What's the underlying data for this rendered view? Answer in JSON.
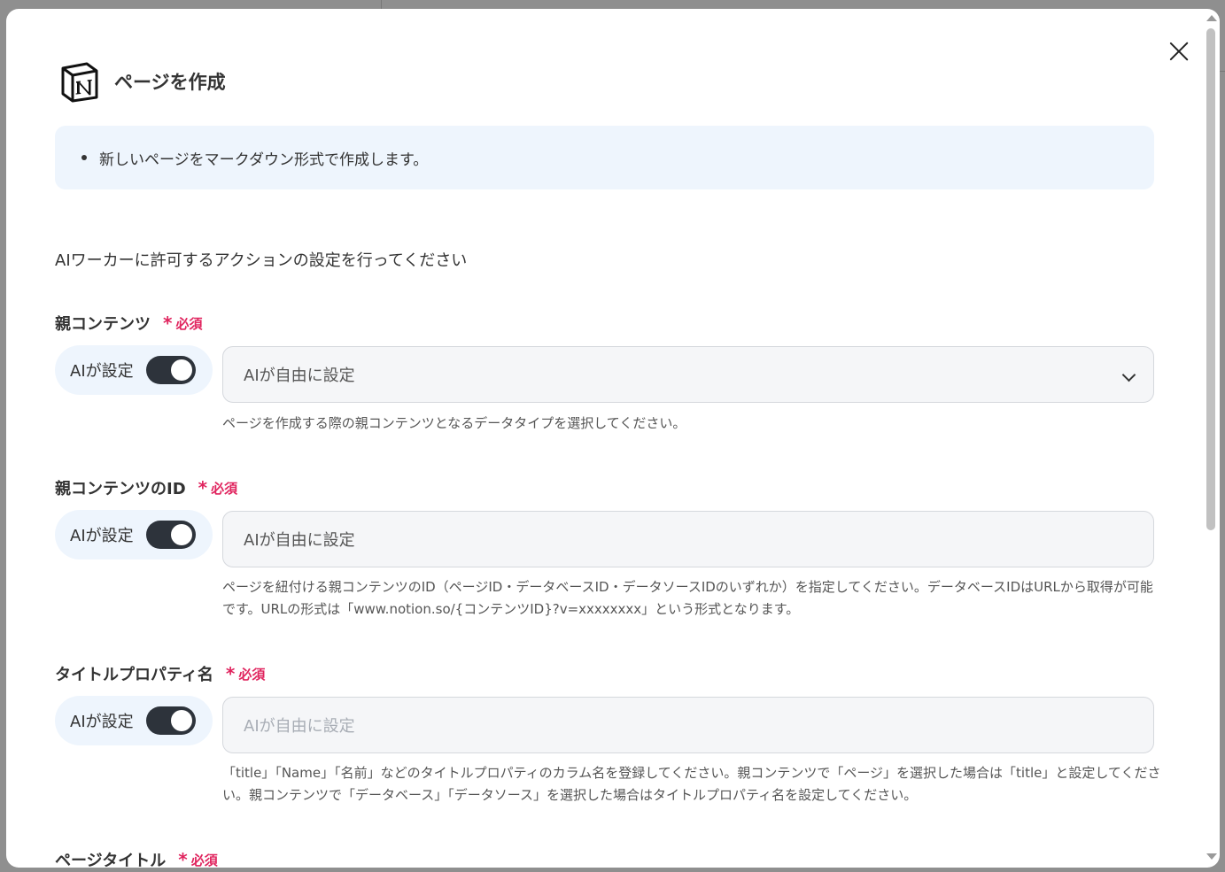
{
  "modal": {
    "title": "ページを作成",
    "info_items": [
      "新しいページをマークダウン形式で作成します。"
    ],
    "intro": "AIワーカーに許可するアクションの設定を行ってください"
  },
  "fields": [
    {
      "label": "親コンテンツ",
      "required": "必須",
      "ai_label": "AIが設定",
      "ai_enabled": true,
      "value": "AIが自由に設定",
      "type": "select",
      "help": "ページを作成する際の親コンテンツとなるデータタイプを選択してください。"
    },
    {
      "label": "親コンテンツのID",
      "required": "必須",
      "ai_label": "AIが設定",
      "ai_enabled": true,
      "value": "AIが自由に設定",
      "type": "text",
      "help": "ページを紐付ける親コンテンツのID（ページID・データベースID・データソースIDのいずれか）を指定してください。データベースIDはURLから取得が可能です。URLの形式は「www.notion.so/{コンテンツID}?v=xxxxxxxx」という形式となります。"
    },
    {
      "label": "タイトルプロパティ名",
      "required": "必須",
      "ai_label": "AIが設定",
      "ai_enabled": true,
      "placeholder": "AIが自由に設定",
      "type": "text",
      "help": "「title」「Name」「名前」などのタイトルプロパティのカラム名を登録してください。親コンテンツで「ページ」を選択した場合は「title」と設定してください。親コンテンツで「データベース」「データソース」を選択した場合はタイトルプロパティ名を設定してください。"
    },
    {
      "label": "ページタイトル",
      "required": "必須"
    }
  ],
  "icons": {
    "logo": "notion-logo",
    "close": "close-icon",
    "dropdown": "chevron-down-icon",
    "required_mark": "asterisk-icon"
  },
  "colors": {
    "required": "#e0245e",
    "toggle_on": "#2d333b",
    "info_bg": "#eef5fd"
  }
}
